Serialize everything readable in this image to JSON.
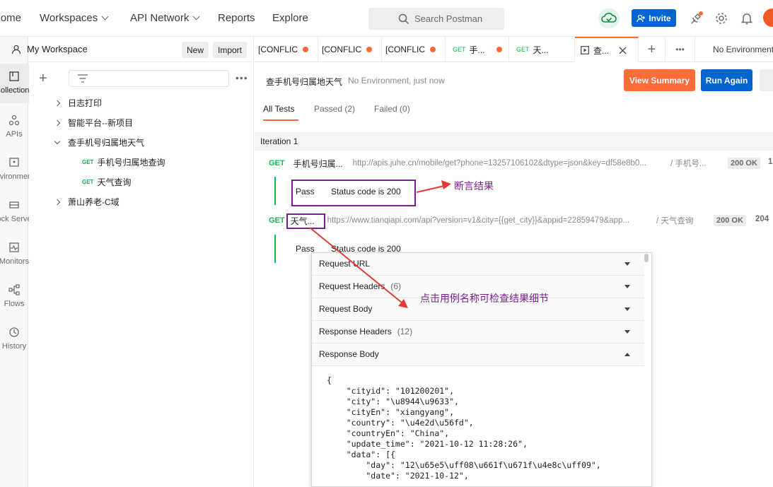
{
  "topbar": {
    "nav": [
      "Home",
      "Workspaces",
      "API Network",
      "Reports",
      "Explore"
    ],
    "search_placeholder": "Search Postman",
    "invite_label": "Invite"
  },
  "rail": [
    "Collections",
    "APIs",
    "Environments",
    "Mock Servers",
    "Monitors",
    "Flows",
    "History"
  ],
  "sidebar": {
    "workspace": "My Workspace",
    "new_label": "New",
    "import_label": "Import",
    "tree": [
      {
        "label": "日志打印"
      },
      {
        "label": "智能平台--新项目"
      },
      {
        "label": "查手机号归属地天气"
      },
      {
        "method": "GET",
        "label": "手机号归属地查询"
      },
      {
        "method": "GET",
        "label": "天气查询"
      },
      {
        "label": "萧山养老-C域"
      }
    ]
  },
  "tabs": {
    "items": [
      {
        "label": "[CONFLIC"
      },
      {
        "label": "[CONFLIC"
      },
      {
        "label": "[CONFLIC"
      },
      {
        "method": "GET",
        "label": "手..."
      },
      {
        "method": "GET",
        "label": "天..."
      },
      {
        "label": "查..."
      }
    ],
    "environment": "No Environment"
  },
  "runner": {
    "title": "查手机号归属地天气",
    "meta": "No Environment, just now",
    "view_summary": "View Summary",
    "run_again": "Run Again",
    "subtabs": [
      "All Tests",
      "Passed (2)",
      "Failed (0)"
    ],
    "iteration": "Iteration 1",
    "requests": [
      {
        "method": "GET",
        "name": "手机号归属...",
        "url": "http://apis.juhe.cn/mobile/get?phone=13257106102&dtype=json&key=df58e8b0...",
        "path": "/ 手机号...",
        "status": "200 OK",
        "time": "1",
        "result": "Pass",
        "assertion": "Status code is 200"
      },
      {
        "method": "GET",
        "name": "天气...",
        "url": "https://www.tianqiapi.com/api?version=v1&city={{get_city}}&appid=22859479&app...",
        "path": "/ 天气查询",
        "status": "200 OK",
        "time": "204",
        "result": "Pass",
        "assertion": "Status code is 200"
      }
    ]
  },
  "annotations": {
    "assert_result": "断言结果",
    "click_hint": "点击用例名称可检查结果细节"
  },
  "detail": {
    "sections": [
      {
        "label": "Request URL",
        "count": ""
      },
      {
        "label": "Request Headers",
        "count": "(6)"
      },
      {
        "label": "Request Body",
        "count": ""
      },
      {
        "label": "Response Headers",
        "count": "(12)"
      },
      {
        "label": "Response Body",
        "count": ""
      }
    ],
    "body": "{\n    \"cityid\": \"101200201\",\n    \"city\": \"\\u8944\\u9633\",\n    \"cityEn\": \"xiangyang\",\n    \"country\": \"\\u4e2d\\u56fd\",\n    \"countryEn\": \"China\",\n    \"update_time\": \"2021-10-12 11:28:26\",\n    \"data\": [{\n        \"day\": \"12\\u65e5\\uff08\\u661f\\u671f\\u4e8c\\uff09\",\n        \"date\": \"2021-10-12\","
  }
}
